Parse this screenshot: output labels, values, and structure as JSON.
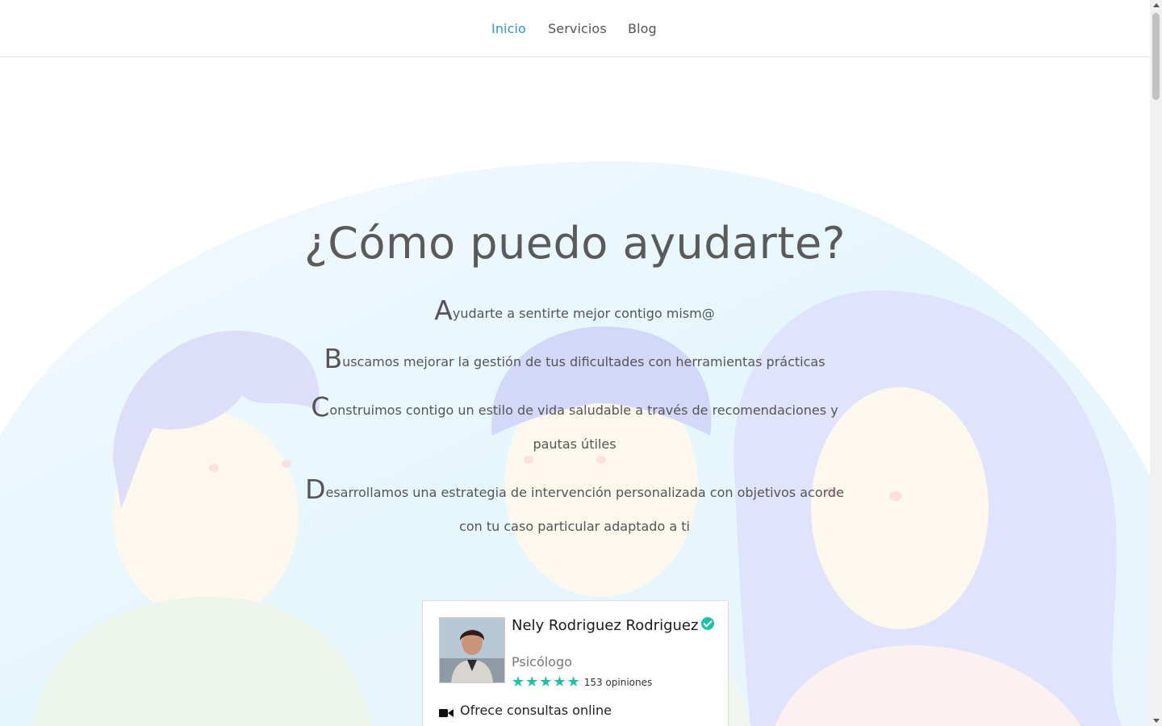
{
  "nav": {
    "items": [
      {
        "label": "Inicio",
        "active": true
      },
      {
        "label": "Servicios",
        "active": false
      },
      {
        "label": "Blog",
        "active": false
      }
    ],
    "active_color": "#2f95de"
  },
  "hero": {
    "title": "¿Cómo puedo ayudarte?",
    "lines": [
      {
        "cap": "A",
        "text": "yudarte a sentirte mejor contigo mism@"
      },
      {
        "cap": "B",
        "text": "uscamos mejorar la gestión de tus dificultades con herramientas prácticas"
      },
      {
        "cap": "C",
        "text": "onstruimos contigo un estilo de vida saludable a través de recomendaciones y pautas útiles"
      },
      {
        "cap": "D",
        "text": "esarrollamos una estrategia de intervención personalizada con objetivos acorde con tu caso particular adaptado a ti"
      }
    ]
  },
  "doctor_card": {
    "name": "Nely Rodriguez Rodriguez",
    "role": "Psicólogo",
    "rating_stars": 5,
    "reviews": "153 opiniones",
    "online_label": "Ofrece consultas online",
    "accent_color": "#1fc1a4"
  }
}
